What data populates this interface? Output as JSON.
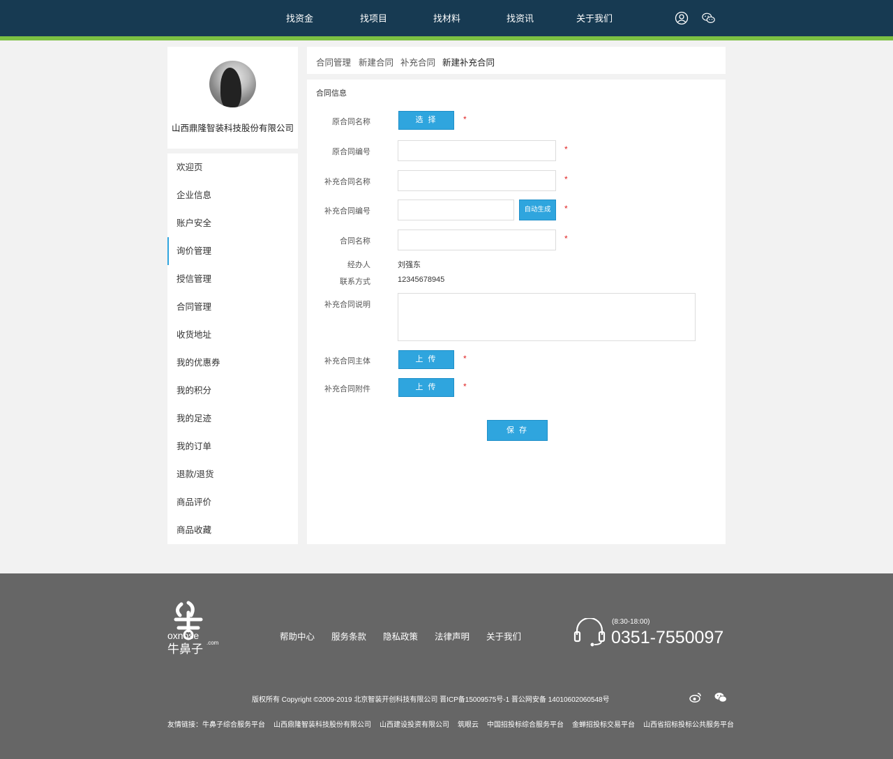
{
  "nav": {
    "items": [
      "找资金",
      "找项目",
      "找材料",
      "找资讯",
      "关于我们"
    ],
    "icons": [
      "user-icon",
      "wechat-icon"
    ]
  },
  "colors": {
    "navy": "#173a52",
    "green": "#7cc143",
    "accent": "#2fa5de",
    "footer": "#666666",
    "required": "#e02020"
  },
  "sidebar": {
    "company_name": "山西鼎隆智装科技股份有限公司",
    "menu": [
      "欢迎页",
      "企业信息",
      "账户安全",
      "询价管理",
      "授信管理",
      "合同管理",
      "收货地址",
      "我的优惠券",
      "我的积分",
      "我的足迹",
      "我的订单",
      "退款/退货",
      "商品评价",
      "商品收藏"
    ],
    "active_index": 3
  },
  "breadcrumb": [
    "合同管理",
    "新建合同",
    "补充合同",
    "新建补充合同"
  ],
  "form": {
    "section_title": "合同信息",
    "labels": {
      "original_name": "原合同名称",
      "original_no": "原合同编号",
      "supp_name": "补充合同名称",
      "supp_no": "补充合同编号",
      "contract_name": "合同名称",
      "handler": "经办人",
      "contact": "联系方式",
      "supp_desc": "补充合同说明",
      "supp_subject": "补充合同主体",
      "supp_attach": "补充合同附件"
    },
    "select_button": "选 择",
    "auto_generate_button": "自动生成",
    "upload_button": "上 传",
    "save_button": "保 存",
    "required_mark": "*",
    "handler_value": "刘强东",
    "contact_value": "12345678945"
  },
  "footer": {
    "links": [
      "帮助中心",
      "服务条款",
      "隐私政策",
      "法律声明",
      "关于我们"
    ],
    "hours": "(8:30-18:00)",
    "phone": "0351-7550097",
    "logo_text": "oxnose",
    "logo_cn": "牛鼻子",
    "logo_com": ".com",
    "copyright": "版权所有  Copyright ©2009-2019   北京智装开创科技有限公司    晋ICP备15009575号-1    晋公网安备 14010602060548号",
    "social_icons": [
      "weibo-icon",
      "wechat-icon"
    ],
    "friends_label": "友情链接：",
    "friends": [
      "牛鼻子综合服务平台",
      "山西鼎隆智装科技股份有限公司",
      "山西建设投资有限公司",
      "筑眼云",
      "中国招投标综合服务平台",
      "金蝉招投标交易平台",
      "山西省招标投标公共服务平台"
    ]
  }
}
